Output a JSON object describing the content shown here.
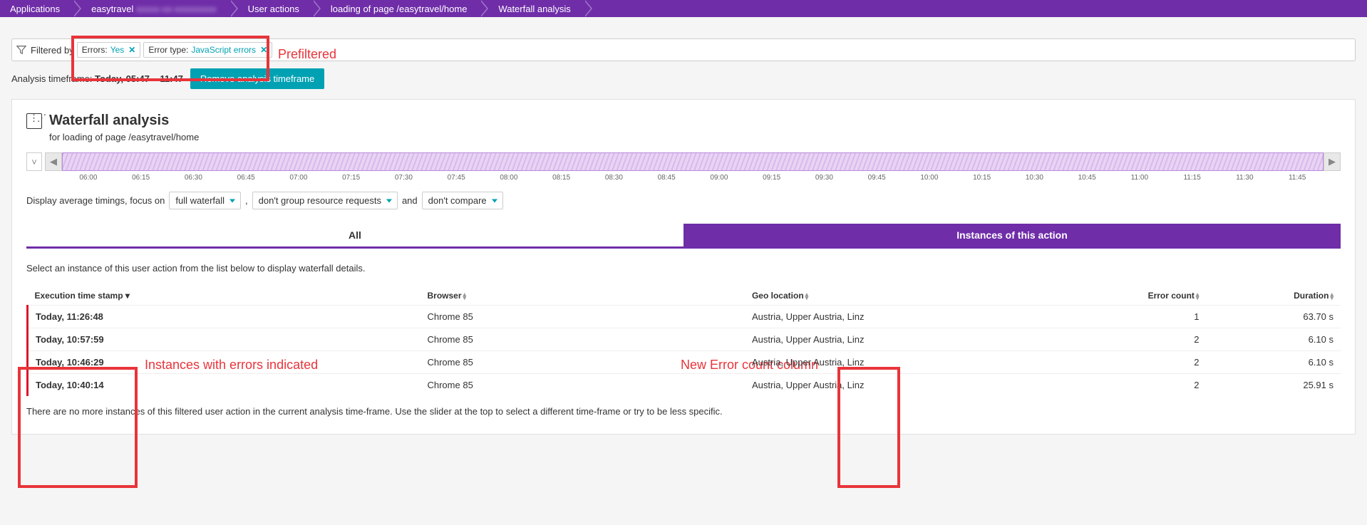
{
  "breadcrumb": {
    "items": [
      {
        "label": "Applications"
      },
      {
        "label": "easytravel",
        "blurred_tail": "xxxxx-xx-xxxxxxxxx"
      },
      {
        "label": "User actions"
      },
      {
        "label": "loading of page /easytravel/home"
      },
      {
        "label": "Waterfall analysis"
      }
    ]
  },
  "filter": {
    "filtered_by_label": "Filtered by",
    "chips": [
      {
        "key": "Errors:",
        "value": "Yes"
      },
      {
        "key": "Error type:",
        "value": "JavaScript errors"
      }
    ]
  },
  "annotations": {
    "prefiltered": "Prefiltered",
    "instances_errors": "Instances with errors indicated",
    "new_error_col": "New Error count column"
  },
  "timeframe": {
    "label": "Analysis timeframe:",
    "value": "Today, 05:47 – 11:47",
    "remove_btn": "Remove analysis timeframe"
  },
  "panel": {
    "title": "Waterfall analysis",
    "subtitle": "for loading of page /easytravel/home"
  },
  "timeline": {
    "ticks": [
      "06:00",
      "06:15",
      "06:30",
      "06:45",
      "07:00",
      "07:15",
      "07:30",
      "07:45",
      "08:00",
      "08:15",
      "08:30",
      "08:45",
      "09:00",
      "09:15",
      "09:30",
      "09:45",
      "10:00",
      "10:15",
      "10:30",
      "10:45",
      "11:00",
      "11:15",
      "11:30",
      "11:45"
    ]
  },
  "controls": {
    "prefix": "Display average timings, focus on",
    "select1": "full waterfall",
    "comma": ",",
    "select2": "don't group resource requests",
    "and": "and",
    "select3": "don't compare"
  },
  "tabs": {
    "all": "All",
    "instances": "Instances of this action"
  },
  "instruction": "Select an instance of this user action from the list below to display waterfall details.",
  "table": {
    "headers": {
      "timestamp": "Execution time stamp",
      "browser": "Browser",
      "geo": "Geo location",
      "error": "Error count",
      "duration": "Duration"
    },
    "rows": [
      {
        "ts": "Today, 11:26:48",
        "browser": "Chrome 85",
        "geo": "Austria, Upper Austria, Linz",
        "errors": "1",
        "duration": "63.70 s"
      },
      {
        "ts": "Today, 10:57:59",
        "browser": "Chrome 85",
        "geo": "Austria, Upper Austria, Linz",
        "errors": "2",
        "duration": "6.10 s"
      },
      {
        "ts": "Today, 10:46:29",
        "browser": "Chrome 85",
        "geo": "Austria, Upper Austria, Linz",
        "errors": "2",
        "duration": "6.10 s"
      },
      {
        "ts": "Today, 10:40:14",
        "browser": "Chrome 85",
        "geo": "Austria, Upper Austria, Linz",
        "errors": "2",
        "duration": "25.91 s"
      }
    ]
  },
  "no_more": "There are no more instances of this filtered user action in the current analysis time-frame. Use the slider at the top to select a different time-frame or try to be less specific."
}
